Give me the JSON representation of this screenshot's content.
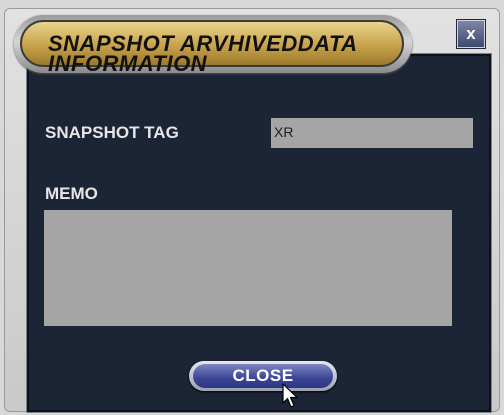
{
  "dialog": {
    "title": "SNAPSHOT ARVHIVEDDATA\nINFORMATION",
    "close_x_label": "x"
  },
  "fields": {
    "snapshot_tag_label": "SNAPSHOT TAG",
    "snapshot_tag_value": "XR",
    "memo_label": "MEMO",
    "memo_value": ""
  },
  "footer": {
    "close_label": "CLOSE"
  },
  "icons": {
    "close": "close-icon",
    "cursor": "mouse-pointer-icon"
  }
}
